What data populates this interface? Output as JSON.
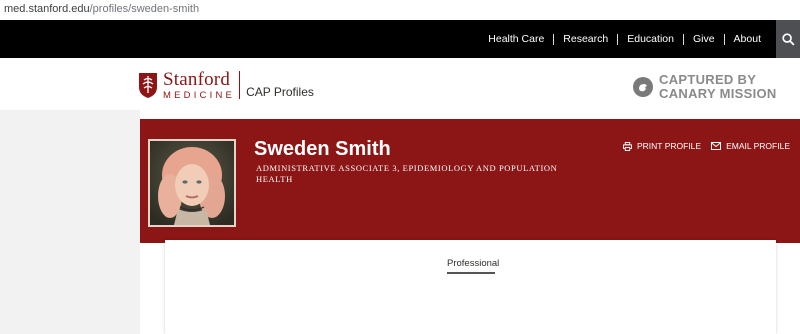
{
  "browser": {
    "url_domain": "med.stanford.edu",
    "url_path": "/profiles/sweden-smith"
  },
  "topnav": {
    "items": [
      "Health Care",
      "Research",
      "Education",
      "Give",
      "About"
    ],
    "search_icon": "search-icon"
  },
  "header": {
    "logo_stanford": "Stanford",
    "logo_medicine": "MEDICINE",
    "product": "CAP Profiles",
    "overlay_line1": "CAPTURED BY",
    "overlay_line2": "CANARY MISSION"
  },
  "profile": {
    "name": "Sweden Smith",
    "title": "ADMINISTRATIVE ASSOCIATE 3, EPIDEMIOLOGY AND POPULATION HEALTH",
    "print_label": "PRINT PROFILE",
    "email_label": "EMAIL PROFILE"
  },
  "tabs": {
    "active": "Professional"
  },
  "colors": {
    "brand_red": "#8c1515",
    "nav_black": "#000000",
    "overlay_gray": "#8a8a8a"
  }
}
